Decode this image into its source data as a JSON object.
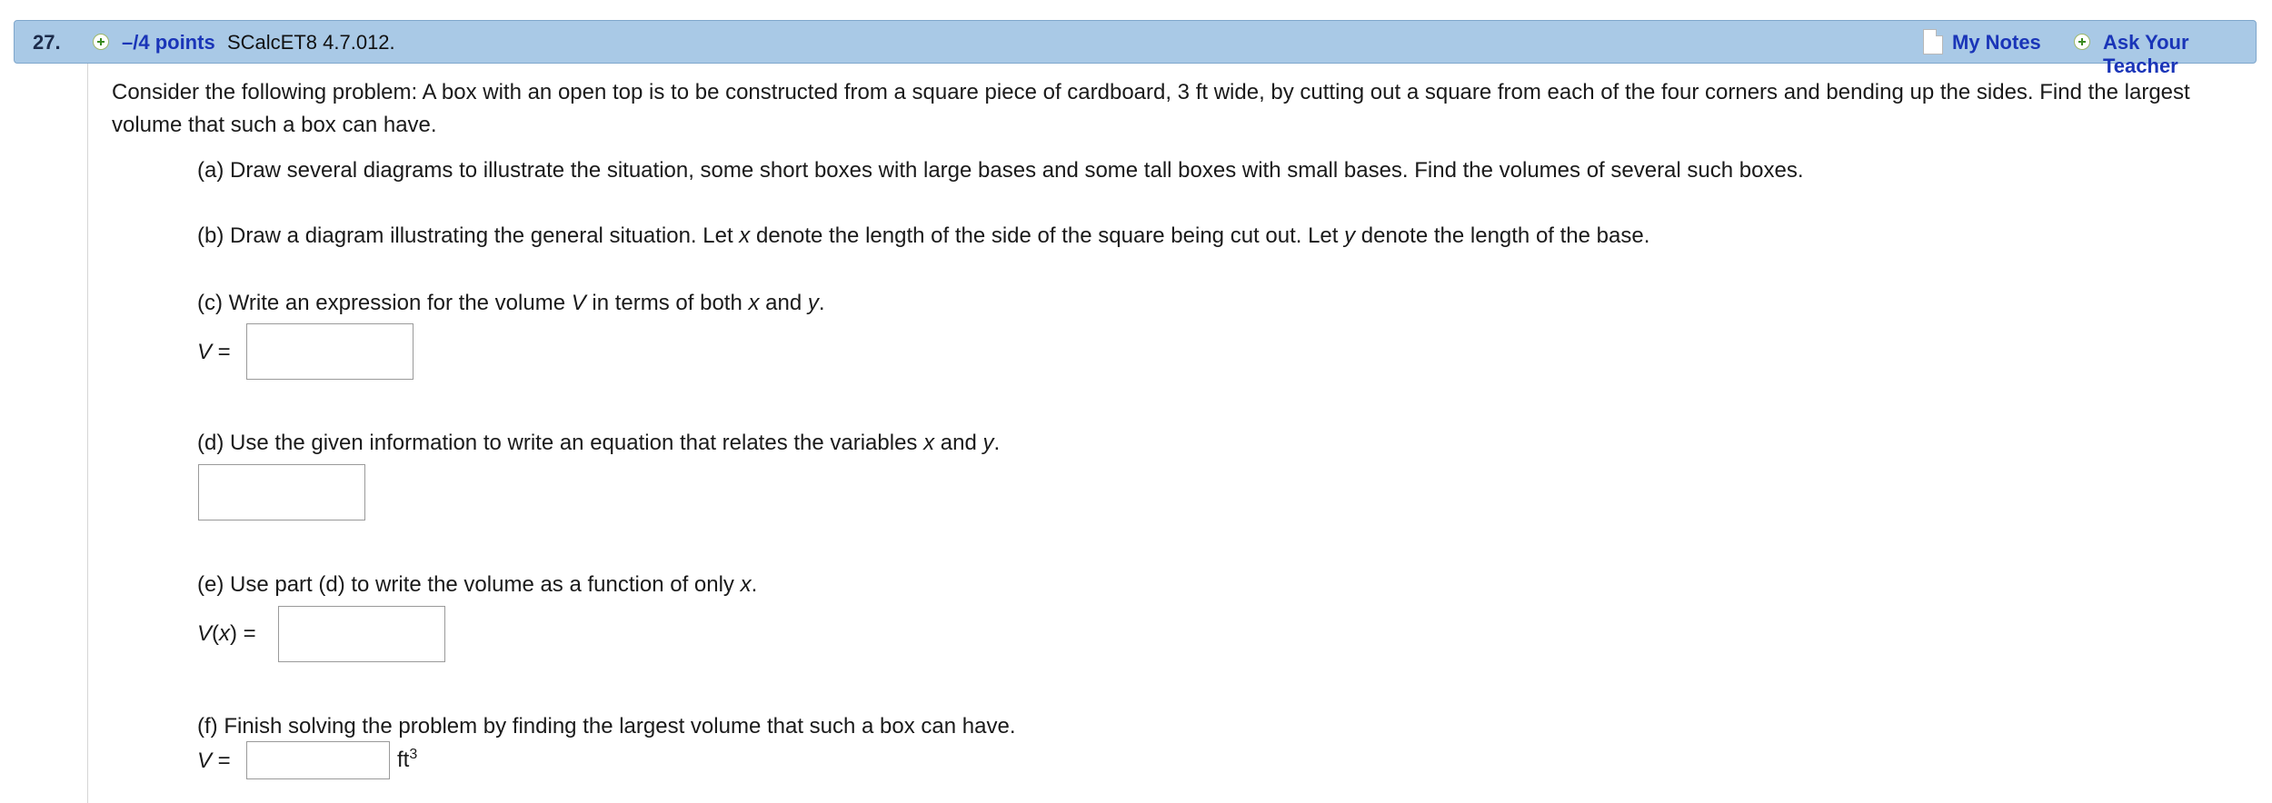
{
  "header": {
    "number": "27.",
    "points": "–/4 points",
    "source": "SCalcET8 4.7.012.",
    "my_notes": "My Notes",
    "ask_teacher": "Ask Your Teacher"
  },
  "problem": {
    "intro": "Consider the following problem: A box with an open top is to be constructed from a square piece of cardboard, 3 ft wide, by cutting out a square from each of the four corners and bending up the sides. Find the largest volume that such a box can have.",
    "part_a": "(a) Draw several diagrams to illustrate the situation, some short boxes with large bases and some tall boxes with small bases. Find the volumes of several such boxes.",
    "part_b_pre": "(b) Draw a diagram illustrating the general situation. Let ",
    "part_b_x": "x",
    "part_b_mid": " denote the length of the side of the square being cut out. Let ",
    "part_b_y": "y",
    "part_b_post": " denote the length of the base.",
    "part_c_pre": "(c) Write an expression for the volume ",
    "part_c_V": "V",
    "part_c_mid1": " in terms of both ",
    "part_c_x": "x",
    "part_c_mid2": " and ",
    "part_c_y": "y",
    "part_c_post": ".",
    "part_c_label_var": "V",
    "part_c_label_eq": " =",
    "part_c_value": "",
    "part_d_pre": "(d) Use the given information to write an equation that relates the variables ",
    "part_d_x": "x",
    "part_d_mid": " and ",
    "part_d_y": "y",
    "part_d_post": ".",
    "part_d_value": "",
    "part_e_pre": "(e) Use part (d) to write the volume as a function of only ",
    "part_e_x": "x",
    "part_e_post": ".",
    "part_e_label_var": "V",
    "part_e_label_arg": "x",
    "part_e_label_open": "(",
    "part_e_label_close": ") =",
    "part_e_value": "",
    "part_f": "(f) Finish solving the problem by finding the largest volume that such a box can have.",
    "part_f_label_var": "V",
    "part_f_label_eq": " =",
    "part_f_value": "",
    "part_f_unit": "ft",
    "part_f_unit_exp": "3"
  },
  "colors": {
    "header_bg": "#a9c9e6",
    "link": "#1a35b8",
    "plus_green": "#3a8a1e"
  },
  "icons": {
    "points": "plus-circle-icon",
    "notes": "note-page-icon",
    "ask": "plus-circle-icon"
  }
}
